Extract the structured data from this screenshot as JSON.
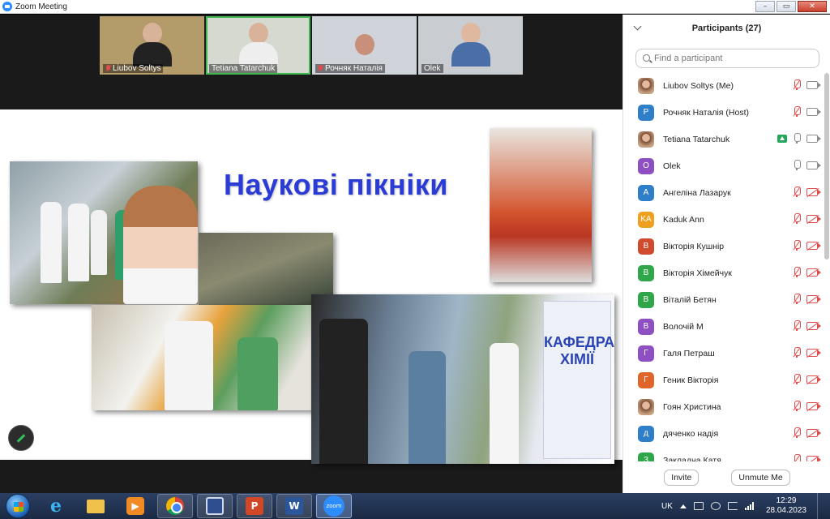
{
  "window": {
    "title": "Zoom Meeting"
  },
  "window_controls": {
    "minimize": "–",
    "maximize": "▭",
    "close": "✕"
  },
  "video_strip": [
    {
      "name": "Liubov Soltys",
      "muted": true,
      "active": false
    },
    {
      "name": "Tetiana Tatarchuk",
      "muted": false,
      "active": true
    },
    {
      "name": "Рочняк Наталія",
      "muted": true,
      "active": false
    },
    {
      "name": "Olek",
      "muted": false,
      "active": false
    }
  ],
  "slide": {
    "title": "Наукові пікніки",
    "poster_text": "КАФЕДРА ХІМІЇ"
  },
  "participants": {
    "header": "Participants (27)",
    "search_placeholder": "Find a participant",
    "list": [
      {
        "name": "Liubov Soltys (Me)",
        "initial": "",
        "photo": true,
        "color": "#9a7a60",
        "mic": "muted",
        "cam": "on",
        "sharing": false
      },
      {
        "name": "Рочняк Наталія (Host)",
        "initial": "Р",
        "photo": false,
        "color": "#2f7fc8",
        "mic": "muted",
        "cam": "on",
        "sharing": false
      },
      {
        "name": "Tetiana Tatarchuk",
        "initial": "",
        "photo": true,
        "color": "#b98a72",
        "mic": "on",
        "cam": "on",
        "sharing": true
      },
      {
        "name": "Olek",
        "initial": "O",
        "photo": false,
        "color": "#8e4fc2",
        "mic": "on",
        "cam": "on",
        "sharing": false
      },
      {
        "name": " Ангеліна Лазарук",
        "initial": "А",
        "photo": false,
        "color": "#2f7fc8",
        "mic": "muted",
        "cam": "off",
        "sharing": false
      },
      {
        "name": "Kaduk Ann",
        "initial": "KA",
        "photo": false,
        "color": "#f0a020",
        "mic": "muted",
        "cam": "off",
        "sharing": false
      },
      {
        "name": "Вікторія Кушнір",
        "initial": "В",
        "photo": false,
        "color": "#d04a2e",
        "mic": "muted",
        "cam": "off",
        "sharing": false
      },
      {
        "name": "Вікторія Хімейчук",
        "initial": "В",
        "photo": false,
        "color": "#2fa64a",
        "mic": "muted",
        "cam": "off",
        "sharing": false
      },
      {
        "name": "Віталій Бетян",
        "initial": "В",
        "photo": false,
        "color": "#2fa64a",
        "mic": "muted",
        "cam": "off",
        "sharing": false
      },
      {
        "name": "Волочій М",
        "initial": "В",
        "photo": false,
        "color": "#8e4fc2",
        "mic": "muted",
        "cam": "off",
        "sharing": false
      },
      {
        "name": "Галя Петраш",
        "initial": "Г",
        "photo": false,
        "color": "#8e4fc2",
        "mic": "muted",
        "cam": "off",
        "sharing": false
      },
      {
        "name": "Геник Вікторія",
        "initial": "Г",
        "photo": false,
        "color": "#e0652a",
        "mic": "muted",
        "cam": "off",
        "sharing": false
      },
      {
        "name": "Гоян Христина",
        "initial": "",
        "photo": true,
        "color": "#a07060",
        "mic": "muted",
        "cam": "off",
        "sharing": false
      },
      {
        "name": "дяченко надія",
        "initial": "д",
        "photo": false,
        "color": "#2f7fc8",
        "mic": "muted",
        "cam": "off",
        "sharing": false
      },
      {
        "name": "Закладна Катя",
        "initial": "З",
        "photo": false,
        "color": "#2fa64a",
        "mic": "muted",
        "cam": "off",
        "sharing": false
      }
    ],
    "invite_label": "Invite",
    "unmute_label": "Unmute Me"
  },
  "taskbar": {
    "apps": [
      {
        "name": "internet-explorer",
        "glyph": "e",
        "cls": "ie",
        "state": ""
      },
      {
        "name": "file-explorer",
        "glyph": "",
        "cls": "folder",
        "state": ""
      },
      {
        "name": "media-player",
        "glyph": "▶",
        "cls": "media",
        "state": ""
      },
      {
        "name": "chrome",
        "glyph": "",
        "cls": "chrome",
        "state": "open"
      },
      {
        "name": "save-app",
        "glyph": "",
        "cls": "floppy",
        "state": "open"
      },
      {
        "name": "powerpoint",
        "glyph": "P",
        "cls": "ppt",
        "state": "open"
      },
      {
        "name": "word",
        "glyph": "W",
        "cls": "word",
        "state": "open"
      },
      {
        "name": "zoom",
        "glyph": "zoom",
        "cls": "zoom",
        "state": "active"
      }
    ],
    "language": "UK",
    "time": "12:29",
    "date": "28.04.2023"
  },
  "colors": {
    "slide_title": "#2b3bd6",
    "zoom_blue": "#2d8cff",
    "muted_red": "#e04b4b",
    "share_green": "#23a55a"
  }
}
